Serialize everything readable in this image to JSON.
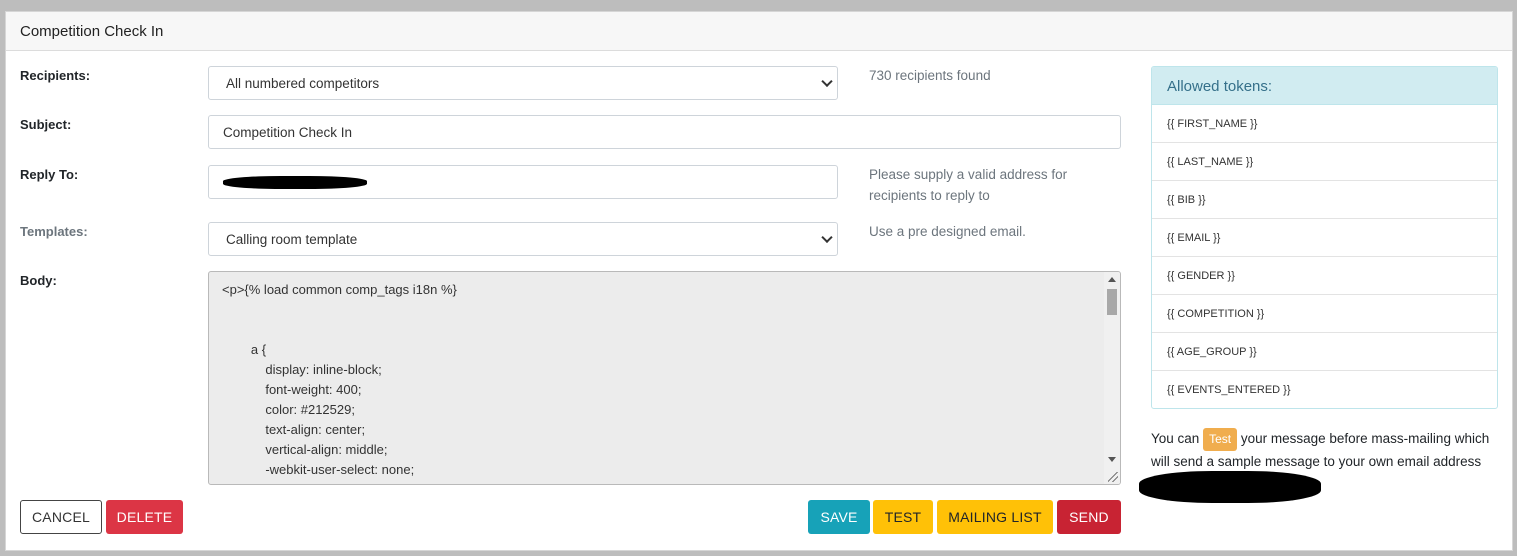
{
  "panel": {
    "title": "Competition Check In"
  },
  "form": {
    "recipients": {
      "label": "Recipients:",
      "value": "All numbered competitors",
      "help": "730 recipients found"
    },
    "subject": {
      "label": "Subject:",
      "value": "Competition Check In"
    },
    "reply_to": {
      "label": "Reply To:",
      "value": "",
      "help": "Please supply a valid address for recipients to reply to"
    },
    "templates": {
      "label": "Templates:",
      "value": "Calling room template",
      "help": "Use a pre designed email."
    },
    "body": {
      "label": "Body:",
      "content": "<p>{% load common comp_tags i18n %}\n\n\n        a {\n            display: inline-block;\n            font-weight: 400;\n            color: #212529;\n            text-align: center;\n            vertical-align: middle;\n            -webkit-user-select: none;\n            -moz-user-select: none;"
    }
  },
  "buttons": {
    "cancel": "CANCEL",
    "delete": "DELETE",
    "save": "SAVE",
    "test": "TEST",
    "mailing_list": "MAILING LIST",
    "send": "SEND"
  },
  "tokens": {
    "title": "Allowed tokens:",
    "items": [
      "{{ FIRST_NAME }}",
      "{{ LAST_NAME }}",
      "{{ BIB }}",
      "{{ EMAIL }}",
      "{{ GENDER }}",
      "{{ COMPETITION }}",
      "{{ AGE_GROUP }}",
      "{{ EVENTS_ENTERED }}"
    ]
  },
  "note": {
    "prefix": "You can",
    "badge": "Test",
    "suffix": "your message before mass-mailing which will send a sample message to your own email address"
  },
  "colors": {
    "save": "#17a2b8",
    "test": "#ffc107",
    "delete": "#dc3545",
    "send": "#c82333",
    "tokens_header_bg": "#d1ecf1"
  }
}
